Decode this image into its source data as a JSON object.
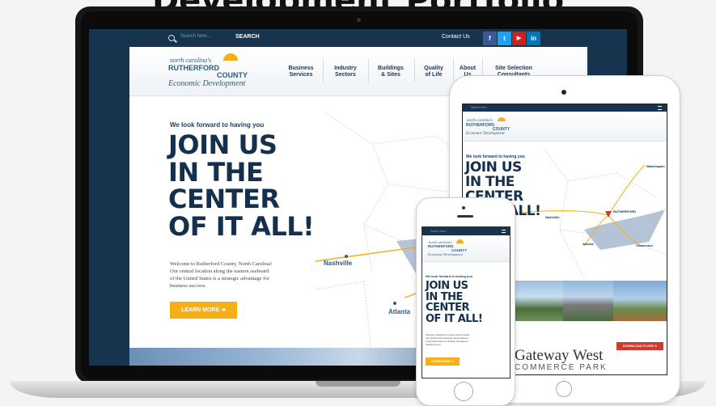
{
  "heading": {
    "text": "Development Portfolio"
  },
  "site": {
    "search_placeholder": "Search here...",
    "search_button": "SEARCH",
    "contact": "Contact Us",
    "social": [
      "f",
      "t",
      "▶",
      "in"
    ],
    "social_colors": [
      "#3b5998",
      "#1da1f2",
      "#cd201f",
      "#0077b5"
    ],
    "logo": {
      "line1": "north carolina's",
      "line2": "RUTHERFORD",
      "line3": "COUNTY",
      "line4": "Economic Development"
    },
    "nav": [
      {
        "l1": "Business",
        "l2": "Services"
      },
      {
        "l1": "Industry",
        "l2": "Sectors"
      },
      {
        "l1": "Buildings",
        "l2": "& Sites"
      },
      {
        "l1": "Quality",
        "l2": "of Life"
      },
      {
        "l1": "About",
        "l2": "Us"
      },
      {
        "l1": "Site Selection",
        "l2": "Consultants"
      }
    ],
    "tagline": "We look forward to having you",
    "headline": [
      "JOIN US",
      "IN THE",
      "CENTER",
      "OF IT ALL!"
    ],
    "body": [
      "Welcome to Rutherford County, North Carolina!",
      "Our central location along the eastern seaboard",
      "of the United States is a strategic advantage for",
      "business success."
    ],
    "learn_more": "LEARN MORE ➔",
    "cities": {
      "nashville": "Nashville",
      "atlanta": "Atlanta",
      "washington": "Washington",
      "rutherford": "RUTHERFORD",
      "charleston": "Charleston"
    },
    "gateway": {
      "title": "Gateway West",
      "subtitle": "COMMERCE PARK",
      "download": "DOWNLOAD FLYER ➔"
    }
  },
  "colors": {
    "navy": "#17344f",
    "accent": "#f5b016",
    "map_land": "#b4c3d6",
    "red": "#d23a2e"
  }
}
